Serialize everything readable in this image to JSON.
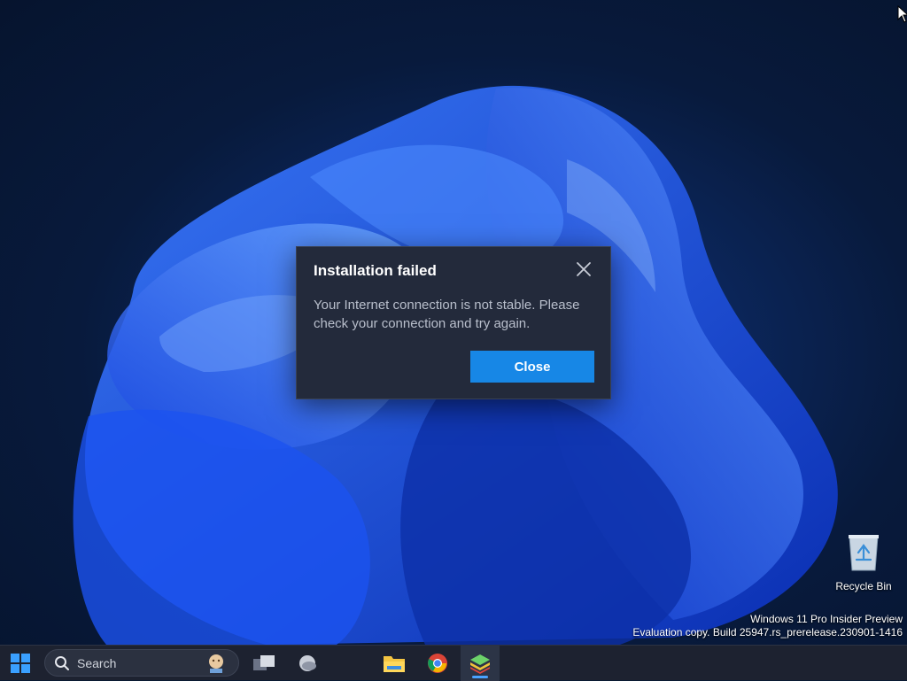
{
  "dialog": {
    "title": "Installation failed",
    "message": "Your Internet connection is not stable. Please check your connection and try again.",
    "close_button": "Close",
    "close_icon": "close-icon",
    "accent": "#1787e6"
  },
  "desktop": {
    "icons": [
      {
        "label": "Recycle Bin",
        "icon": "recycle-bin-icon"
      }
    ],
    "watermark": {
      "line1": "Windows 11 Pro Insider Preview",
      "line2": "Evaluation copy. Build 25947.rs_prerelease.230901-1416"
    }
  },
  "taskbar": {
    "start_icon": "windows-start-icon",
    "search_placeholder": "Search",
    "apps": [
      {
        "name": "task-view-icon"
      },
      {
        "name": "widgets-weather-icon"
      },
      {
        "name": "file-explorer-icon"
      },
      {
        "name": "chrome-icon"
      },
      {
        "name": "bluestacks-icon",
        "active": true
      }
    ]
  }
}
